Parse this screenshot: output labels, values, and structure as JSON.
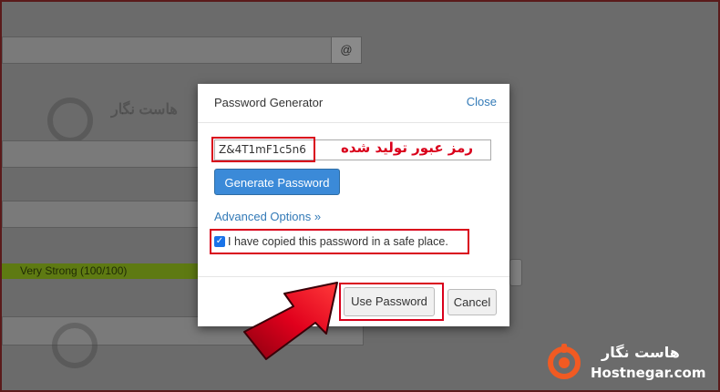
{
  "background": {
    "at_symbol": "@",
    "strength_label": "Very Strong (100/100)",
    "watermark_text": "هاست نگار"
  },
  "modal": {
    "title": "Password Generator",
    "close_label": "Close",
    "generated_password": "Z&4T1mF1c5n6",
    "generate_button": "Generate Password",
    "advanced_options": "Advanced Options »",
    "confirm_checkbox_checked": true,
    "confirm_label": "I have copied this password in a safe place.",
    "use_password_button": "Use Password",
    "cancel_button": "Cancel"
  },
  "annotations": {
    "password_caption": "رمز عبور تولید شده",
    "highlight_color": "#d9001b",
    "arrow_color": "#d9001b"
  },
  "brand": {
    "name_fa": "هاست نگار",
    "name_en": "Hostnegar.com",
    "accent": "#f15a22"
  }
}
